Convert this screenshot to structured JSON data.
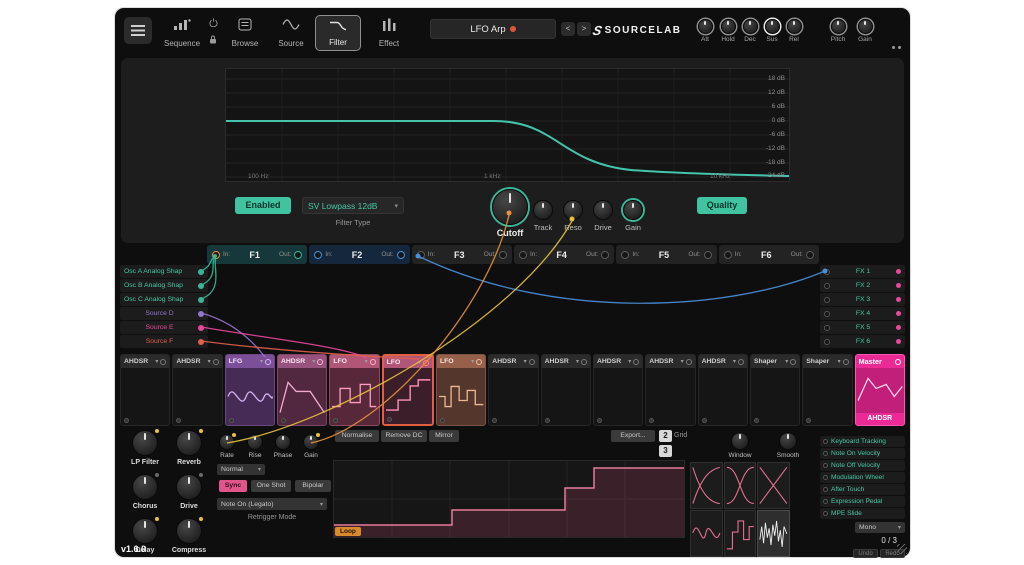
{
  "app": {
    "version": "v1.6.0"
  },
  "topbar": {
    "tabs": [
      {
        "label": "Sequence"
      },
      {
        "label": "Browse"
      },
      {
        "label": "Source"
      },
      {
        "label": "Filter"
      },
      {
        "label": "Effect"
      }
    ],
    "preset_name": "LFO Arp",
    "prev_label": "<",
    "next_label": ">",
    "brand": "SOURCELAB",
    "env_knobs": [
      {
        "label": "Att"
      },
      {
        "label": "Hold"
      },
      {
        "label": "Dec"
      },
      {
        "label": "Sus"
      },
      {
        "label": "Rel"
      }
    ],
    "pitch_label": "Pitch",
    "gain_label": "Gain"
  },
  "filter": {
    "db_labels": [
      "18 dB",
      "12 dB",
      "6 dB",
      "0 dB",
      "-6 dB",
      "-12 dB",
      "-18 dB",
      "-24 dB"
    ],
    "freq_labels": [
      "100 Hz",
      "1 kHz",
      "10 kHz"
    ],
    "enabled_label": "Enabled",
    "type_value": "SV Lowpass 12dB",
    "type_caption": "Filter Type",
    "knobs": [
      {
        "label": "Cutoff"
      },
      {
        "label": "Track"
      },
      {
        "label": "Reso"
      },
      {
        "label": "Drive"
      },
      {
        "label": "Gain"
      }
    ],
    "quality_label": "Quality"
  },
  "filter_slots": [
    {
      "name": "F1",
      "in_label": "In:",
      "out_label": "Out:"
    },
    {
      "name": "F2",
      "in_label": "In:",
      "out_label": "Out:"
    },
    {
      "name": "F3",
      "in_label": "In:",
      "out_label": "Out:"
    },
    {
      "name": "F4",
      "in_label": "In:",
      "out_label": "Out:"
    },
    {
      "name": "F5",
      "in_label": "In:",
      "out_label": "Out:"
    },
    {
      "name": "F6",
      "in_label": "In:",
      "out_label": "Out:"
    }
  ],
  "sources": [
    {
      "label": "Osc A Analog Shap",
      "color": "#39b797"
    },
    {
      "label": "Osc B Analog Shap",
      "color": "#39b797"
    },
    {
      "label": "Osc C Analog Shap",
      "color": "#39b797"
    },
    {
      "label": "Source D",
      "color": "#9575cd"
    },
    {
      "label": "Source E",
      "color": "#e9489c"
    },
    {
      "label": "Source F",
      "color": "#e0604a"
    }
  ],
  "fx_slots": [
    {
      "label": "FX 1"
    },
    {
      "label": "FX 2"
    },
    {
      "label": "FX 3"
    },
    {
      "label": "FX 4"
    },
    {
      "label": "FX 5"
    },
    {
      "label": "FX 6"
    }
  ],
  "modulators": [
    {
      "label": "AHDSR"
    },
    {
      "label": "AHDSR"
    },
    {
      "label": "LFG"
    },
    {
      "label": "AHDSR"
    },
    {
      "label": "LFO"
    },
    {
      "label": "LFO"
    },
    {
      "label": "LFO"
    },
    {
      "label": "AHDSR"
    },
    {
      "label": "AHDSR"
    },
    {
      "label": "AHDSR"
    },
    {
      "label": "AHDSR"
    },
    {
      "label": "AHDSR"
    },
    {
      "label": "Shaper"
    },
    {
      "label": "Shaper"
    },
    {
      "label": "Master",
      "sub": "AHDSR"
    }
  ],
  "fx_knobs": [
    {
      "label": "LP Filter"
    },
    {
      "label": "Reverb"
    },
    {
      "label": "Chorus"
    },
    {
      "label": "Drive"
    },
    {
      "label": "Delay"
    },
    {
      "label": "Compress"
    }
  ],
  "lfo": {
    "knobs": [
      {
        "label": "Rate"
      },
      {
        "label": "Rise"
      },
      {
        "label": "Phase"
      },
      {
        "label": "Gain"
      }
    ],
    "mode_value": "Normal",
    "sync_label": "Sync",
    "one_shot_label": "One Shot",
    "bipolar_label": "Bipolar",
    "retrigger_value": "Note On (Legato)",
    "retrigger_caption": "Retrigger Mode"
  },
  "editor": {
    "normalise_label": "Normalise",
    "remove_dc_label": "Remove DC",
    "mirror_label": "Mirror",
    "export_label": "Export...",
    "grid_x": "2",
    "grid_y": "3",
    "grid_label": "Grid",
    "window_label": "Window",
    "smooth_label": "Smooth",
    "loop_label": "Loop"
  },
  "mod_inputs": [
    {
      "label": "Keyboard Tracking"
    },
    {
      "label": "Note On Velocity"
    },
    {
      "label": "Note Off Velocity"
    },
    {
      "label": "Modulation Wheel"
    },
    {
      "label": "After Touch"
    },
    {
      "label": "Expression Pedal"
    },
    {
      "label": "MPE Slide"
    }
  ],
  "voice": {
    "mode_value": "Mono",
    "count": "0 / 3"
  },
  "history": {
    "undo_label": "Undo",
    "redo_label": "Redo"
  },
  "colors": {
    "teal": "#39b797",
    "blue": "#4a90d9",
    "purple": "#9575cd",
    "pink": "#e9489c",
    "magenta": "#ec2a96",
    "orange": "#e8923a",
    "yellow": "#e8c33a",
    "red": "#e0604a"
  }
}
